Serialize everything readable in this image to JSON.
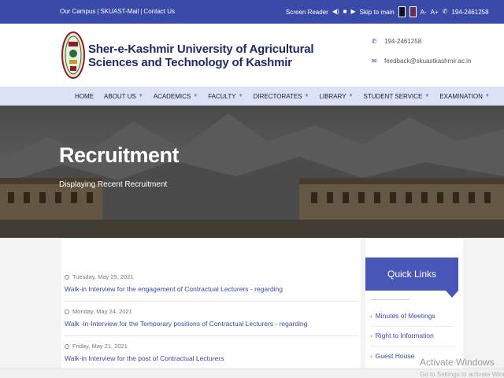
{
  "topbar": {
    "links": [
      "Our Campus",
      "SKUAST-Mail",
      "Contact Us"
    ],
    "screen_reader": "Screen Reader",
    "skip_to_main": "Skip to main",
    "font_decrease": "A-",
    "font_increase": "A+",
    "phone": "194-2461258",
    "bg_color": "#3a4aa8"
  },
  "header": {
    "university_name_line1": "Sher-e-Kashmir University of Agricultural",
    "university_name_line2": "Sciences and Technology of Kashmir",
    "phone": "194-2461258",
    "email": "feedback@skuastkashmir.ac.in",
    "icons": [
      "university-logo",
      "phone-icon",
      "email-icon"
    ]
  },
  "nav": {
    "items": [
      {
        "label": "HOME",
        "has_dropdown": false
      },
      {
        "label": "ABOUT US",
        "has_dropdown": true
      },
      {
        "label": "ACADEMICS",
        "has_dropdown": true
      },
      {
        "label": "FACULTY",
        "has_dropdown": true
      },
      {
        "label": "DIRECTORATES",
        "has_dropdown": true
      },
      {
        "label": "LIBRARY",
        "has_dropdown": true
      },
      {
        "label": "STUDENT SERVICE",
        "has_dropdown": true
      },
      {
        "label": "EXAMINATION",
        "has_dropdown": true
      }
    ],
    "bg_color": "#dde3f7"
  },
  "banner": {
    "title": "Recruitment",
    "subtitle": "Displaying Recent Recruitment"
  },
  "recruitments": [
    {
      "date": "Tuesday, May 25, 2021",
      "title": "Walk-in Interview for the engagement of Contractual Lecturers - regarding"
    },
    {
      "date": "Monday, May 24, 2021",
      "title": "Walk -in-Interview for the Temporary positions of Contractual Lecturers - regarding"
    },
    {
      "date": "Friday, May 21, 2021",
      "title": "Walk-in Interview for the post of Contractual Lecturers"
    }
  ],
  "quick_links": {
    "heading": "Quick Links",
    "items": [
      "Minutes of Meetings",
      "Right to Information",
      "Guest House"
    ],
    "accent_color": "#4857b7"
  },
  "watermark": {
    "title": "Activate Windows",
    "subtitle": "Go to Settings to activate Windows."
  }
}
